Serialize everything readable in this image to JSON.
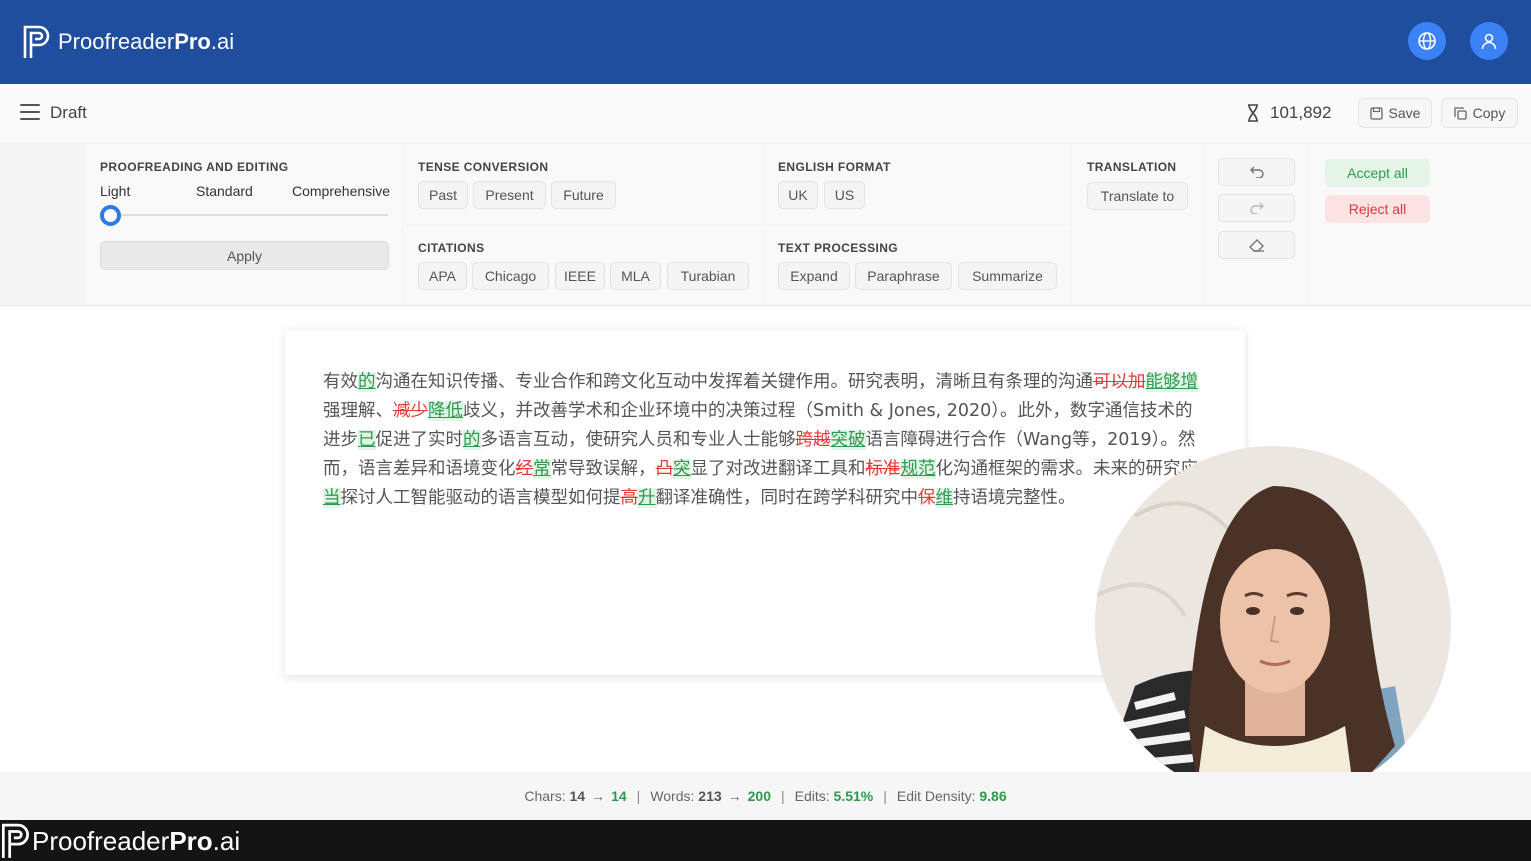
{
  "header": {
    "logo_regular": "Proofreader",
    "logo_bold": "Pro",
    "logo_suffix": ".ai",
    "globe_icon": "globe-icon",
    "user_icon": "user-icon"
  },
  "subbar": {
    "title": "Draft",
    "token_count": "101,892",
    "save_label": "Save",
    "copy_label": "Copy"
  },
  "toolbar": {
    "proofreading": {
      "title": "PROOFREADING AND EDITING",
      "levels": [
        "Light",
        "Standard",
        "Comprehensive"
      ],
      "selected_level": "Light",
      "apply_label": "Apply"
    },
    "tense": {
      "title": "TENSE CONVERSION",
      "options": [
        "Past",
        "Present",
        "Future"
      ]
    },
    "english_format": {
      "title": "ENGLISH FORMAT",
      "options": [
        "UK",
        "US"
      ]
    },
    "translation": {
      "title": "TRANSLATION",
      "button": "Translate to"
    },
    "citations": {
      "title": "CITATIONS",
      "options": [
        "APA",
        "Chicago",
        "IEEE",
        "MLA",
        "Turabian"
      ]
    },
    "text_processing": {
      "title": "TEXT PROCESSING",
      "options": [
        "Expand",
        "Paraphrase",
        "Summarize"
      ]
    },
    "accept_all": "Accept all",
    "reject_all": "Reject all"
  },
  "editor": {
    "segments": [
      {
        "t": "有效",
        "k": "n"
      },
      {
        "t": "的",
        "k": "i"
      },
      {
        "t": "沟通在知识传播、专业合作和跨文化互动中发挥着关键作用。研究表明，清晰且有条理的沟通",
        "k": "n"
      },
      {
        "t": "可以加",
        "k": "d"
      },
      {
        "t": "能够增",
        "k": "i"
      },
      {
        "t": "强理解、",
        "k": "n"
      },
      {
        "t": "减少",
        "k": "d"
      },
      {
        "t": "降低",
        "k": "i"
      },
      {
        "t": "歧义，并改善学术和企业环境中的决策过程（Smith & Jones, 2020）。此外，数字通信技术的进步",
        "k": "n"
      },
      {
        "t": "已",
        "k": "i"
      },
      {
        "t": "促进了实时",
        "k": "n"
      },
      {
        "t": "的",
        "k": "i"
      },
      {
        "t": "多语言互动，使研究人员和专业人士能够",
        "k": "n"
      },
      {
        "t": "跨越",
        "k": "d"
      },
      {
        "t": "突破",
        "k": "i"
      },
      {
        "t": "语言障碍进行合作（Wang等，2019）。然而，语言差异和语境变化",
        "k": "n"
      },
      {
        "t": "经",
        "k": "d"
      },
      {
        "t": "常",
        "k": "i"
      },
      {
        "t": "常导致误解，",
        "k": "n"
      },
      {
        "t": "凸",
        "k": "d"
      },
      {
        "t": "突",
        "k": "i"
      },
      {
        "t": "显了对改进翻译工具和",
        "k": "n"
      },
      {
        "t": "标准",
        "k": "d"
      },
      {
        "t": "规范",
        "k": "i"
      },
      {
        "t": "化沟通框架的需求。未来的研究应",
        "k": "n"
      },
      {
        "t": "当",
        "k": "i"
      },
      {
        "t": "探讨人工智能驱动的语言模型如何提",
        "k": "n"
      },
      {
        "t": "高",
        "k": "d"
      },
      {
        "t": "升",
        "k": "i"
      },
      {
        "t": "翻译准确性，同时在跨学科研究中",
        "k": "n"
      },
      {
        "t": "保",
        "k": "d"
      },
      {
        "t": "维",
        "k": "i"
      },
      {
        "t": "持语境完整性。",
        "k": "n"
      }
    ]
  },
  "stats": {
    "chars_label": "Chars:",
    "chars_before": "14",
    "chars_after": "14",
    "words_label": "Words:",
    "words_before": "213",
    "words_after": "200",
    "edits_label": "Edits:",
    "edits_value": "5.51%",
    "density_label": "Edit Density:",
    "density_value": "9.86"
  },
  "brand_footer": {
    "regular": "Proofreader",
    "bold": "Pro",
    "suffix": ".ai"
  },
  "colors": {
    "header": "#1f4e9e",
    "accent": "#3b82f6",
    "insert": "#2e9a4e",
    "delete": "#e53935"
  }
}
